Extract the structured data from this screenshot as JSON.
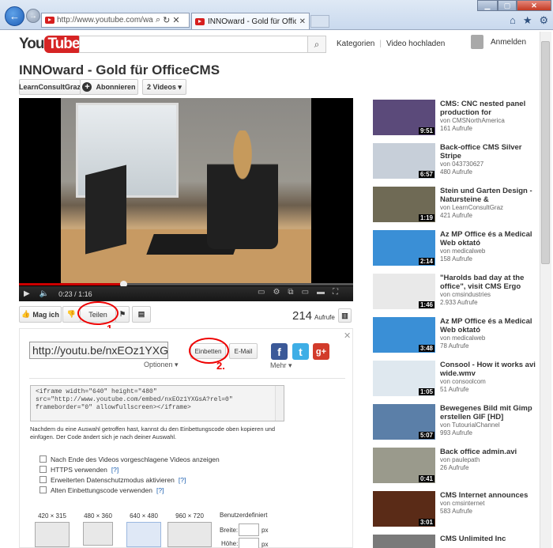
{
  "browser": {
    "url": "http://www.youtube.com/watch?v=",
    "tab_title": "INNOward - Gold für Office..."
  },
  "header": {
    "logo_you": "You",
    "logo_tube": "Tube",
    "search_placeholder": "",
    "nav_categories": "Kategorien",
    "nav_upload": "Video hochladen",
    "sign_in": "Anmelden"
  },
  "video": {
    "title": "INNOward - Gold für OfficeCMS",
    "channel": "LearnConsultGraz",
    "subscribe": "Abonnieren",
    "videos_count": "2 Videos",
    "time": "0:23 / 1:16",
    "progress": 0.302,
    "like": "Mag ich",
    "share": "Teilen",
    "views": "214",
    "views_label": "Aufrufe",
    "marker1": "1.",
    "marker2": "2."
  },
  "share": {
    "link": "http://youtu.be/nxEOz1YXGsA",
    "options": "Optionen ▾",
    "embed": "Einbetten",
    "email": "E-Mail",
    "more": "Mehr ▾",
    "code": "<iframe width=\"640\" height=\"480\"\nsrc=\"http://www.youtube.com/embed/nxEOz1YXGsA?rel=0\"\nframeborder=\"0\" allowfullscreen></iframe>",
    "hint": "Nachdem du eine Auswahl getroffen hast, kannst du den Einbettungscode oben kopieren und einfügen. Der Code ändert sich je nach deiner Auswahl.",
    "checkboxes": [
      {
        "label": "Nach Ende des Videos vorgeschlagene Videos anzeigen",
        "q": ""
      },
      {
        "label": "HTTPS verwenden",
        "q": "[?]"
      },
      {
        "label": "Erweiterten Datenschutzmodus aktivieren",
        "q": "[?]"
      },
      {
        "label": "Alten Einbettungscode verwenden",
        "q": "[?]"
      }
    ],
    "sizes": [
      "420 × 315",
      "480 × 360",
      "640 × 480",
      "960 × 720"
    ],
    "custom": "Benutzerdefiniert",
    "width_label": "Breite:",
    "height_label": "Höhe:",
    "px": "px"
  },
  "related": [
    {
      "title": "CMS: CNC nested panel production for",
      "channel": "von CMSNorthAmerica",
      "views": "161 Aufrufe",
      "dur": "9:51",
      "color": "#5b4a7a"
    },
    {
      "title": "Back-office CMS Silver Stripe",
      "channel": "von 043730627",
      "views": "480 Aufrufe",
      "dur": "6:57",
      "color": "#c7cfd9"
    },
    {
      "title": "Stein und Garten Design - Natursteine &",
      "channel": "von LearnConsultGraz",
      "views": "421 Aufrufe",
      "dur": "1:19",
      "color": "#6f6a55"
    },
    {
      "title": "Az MP Office és a Medical Web oktató",
      "channel": "von medicalweb",
      "views": "158 Aufrufe",
      "dur": "2:14",
      "color": "#3a8fd6"
    },
    {
      "title": "\"Harolds bad day at the office\", visit CMS Ergo",
      "channel": "von cmsindustries",
      "views": "2.933 Aufrufe",
      "dur": "1:46",
      "color": "#e9e9e9"
    },
    {
      "title": "Az MP Office és a Medical Web oktató",
      "channel": "von medicalweb",
      "views": "78 Aufrufe",
      "dur": "3:48",
      "color": "#3a8fd6"
    },
    {
      "title": "Consool - How it works avi wide.wmv",
      "channel": "von consoolcom",
      "views": "51 Aufrufe",
      "dur": "1:05",
      "color": "#dfe8ef"
    },
    {
      "title": "Bewegenes Bild mit Gimp erstellen GIF [HD]",
      "channel": "von TutourialChannel",
      "views": "993 Aufrufe",
      "dur": "5:07",
      "color": "#5b7fa8"
    },
    {
      "title": "Back office admin.avi",
      "channel": "von paulepath",
      "views": "26 Aufrufe",
      "dur": "0:41",
      "color": "#9a9a8c"
    },
    {
      "title": "CMS Internet announces",
      "channel": "von cmsinternet",
      "views": "583 Aufrufe",
      "dur": "3:01",
      "color": "#5a2b17"
    },
    {
      "title": "CMS Unlimited Inc",
      "channel": "",
      "views": "",
      "dur": "",
      "color": "#7a7a7a"
    }
  ]
}
